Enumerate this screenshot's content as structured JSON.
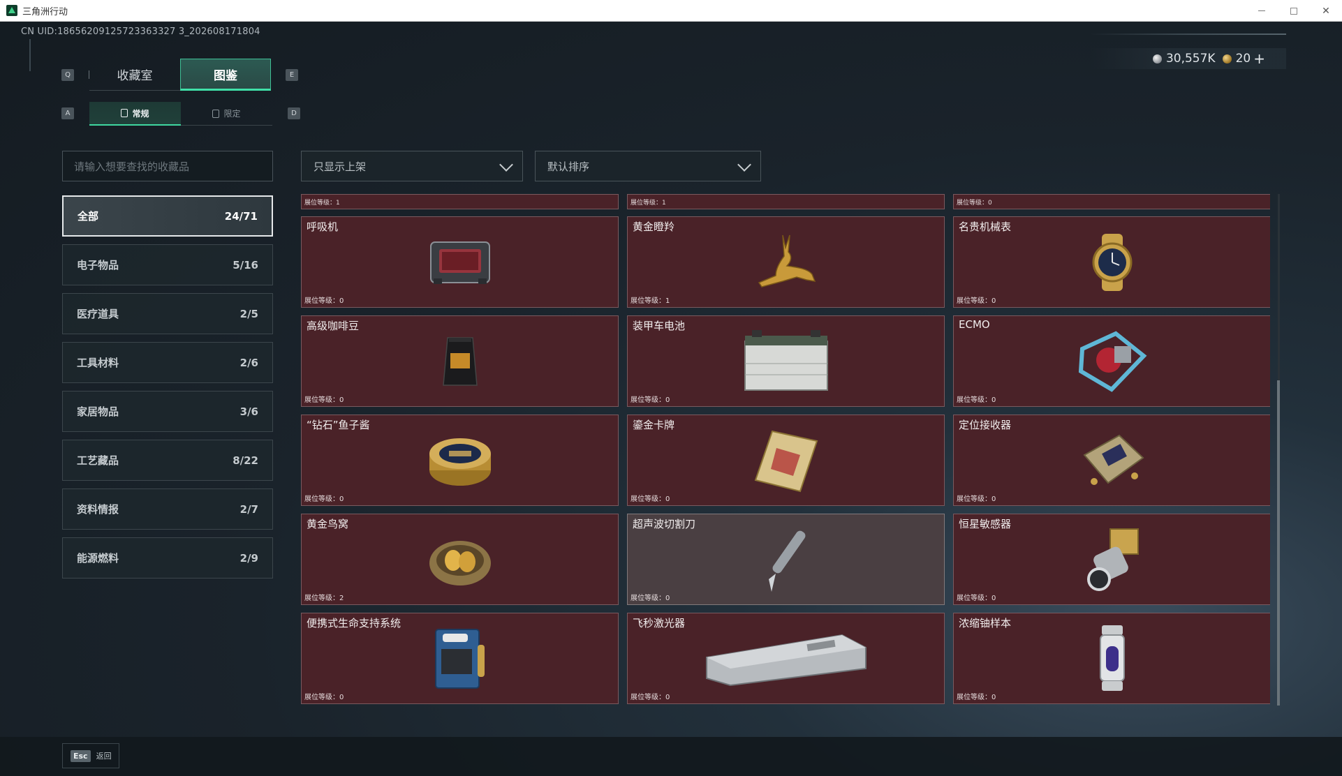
{
  "window": {
    "title": "三角洲行动"
  },
  "uid": "CN UID:18656209125723363327 3_202608171804",
  "currency": {
    "silver": "30,557K",
    "gold": "20",
    "plus": "+"
  },
  "keys": {
    "q": "Q",
    "e": "E",
    "a": "A",
    "d": "D"
  },
  "tabs": [
    {
      "label": "收藏室"
    },
    {
      "label": "图鉴"
    }
  ],
  "subtabs": [
    {
      "label": "常规"
    },
    {
      "label": "限定"
    }
  ],
  "search": {
    "placeholder": "请输入想要查找的收藏品"
  },
  "filters": {
    "display": "只显示上架",
    "sort": "默认排序"
  },
  "categories": [
    {
      "label": "全部",
      "count": "24/71"
    },
    {
      "label": "电子物品",
      "count": "5/16"
    },
    {
      "label": "医疗道具",
      "count": "2/5"
    },
    {
      "label": "工具材料",
      "count": "2/6"
    },
    {
      "label": "家居物品",
      "count": "3/6"
    },
    {
      "label": "工艺藏品",
      "count": "8/22"
    },
    {
      "label": "资料情报",
      "count": "2/7"
    },
    {
      "label": "能源燃料",
      "count": "2/9"
    }
  ],
  "partial_row": [
    {
      "level": "展位等级：1"
    },
    {
      "level": "展位等级：1"
    },
    {
      "level": "展位等级：0"
    }
  ],
  "items": [
    {
      "name": "呼吸机",
      "level": "展位等级：0",
      "icon": "ventilator-icon"
    },
    {
      "name": "黄金瞪羚",
      "level": "展位等级：1",
      "icon": "gold-gazelle-icon"
    },
    {
      "name": "名贵机械表",
      "level": "展位等级：0",
      "icon": "watch-icon"
    },
    {
      "name": "高级咖啡豆",
      "level": "展位等级：0",
      "icon": "coffee-bag-icon"
    },
    {
      "name": "装甲车电池",
      "level": "展位等级：0",
      "icon": "battery-icon"
    },
    {
      "name": "ECMO",
      "level": "展位等级：0",
      "icon": "ecmo-icon"
    },
    {
      "name": "“钻石”鱼子酱",
      "level": "展位等级：0",
      "icon": "caviar-icon"
    },
    {
      "name": "鎏金卡牌",
      "level": "展位等级：0",
      "icon": "gold-card-icon"
    },
    {
      "name": "定位接收器",
      "level": "展位等级：0",
      "icon": "receiver-icon"
    },
    {
      "name": "黄金鸟窝",
      "level": "展位等级：2",
      "icon": "gold-nest-icon"
    },
    {
      "name": "超声波切割刀",
      "level": "展位等级：0",
      "icon": "ultrasonic-cutter-icon"
    },
    {
      "name": "恒星敏感器",
      "level": "展位等级：0",
      "icon": "star-sensor-icon"
    },
    {
      "name": "便携式生命支持系统",
      "level": "展位等级：0",
      "icon": "life-support-icon"
    },
    {
      "name": "飞秒激光器",
      "level": "展位等级：0",
      "icon": "laser-icon"
    },
    {
      "name": "浓缩铀样本",
      "level": "展位等级：0",
      "icon": "uranium-icon"
    }
  ],
  "footer": {
    "esc_key": "Esc",
    "esc_label": "返回"
  },
  "colors": {
    "accent": "#3fe0a8",
    "card_bg": "#4a2228",
    "card_grey": "#4a3f42"
  }
}
